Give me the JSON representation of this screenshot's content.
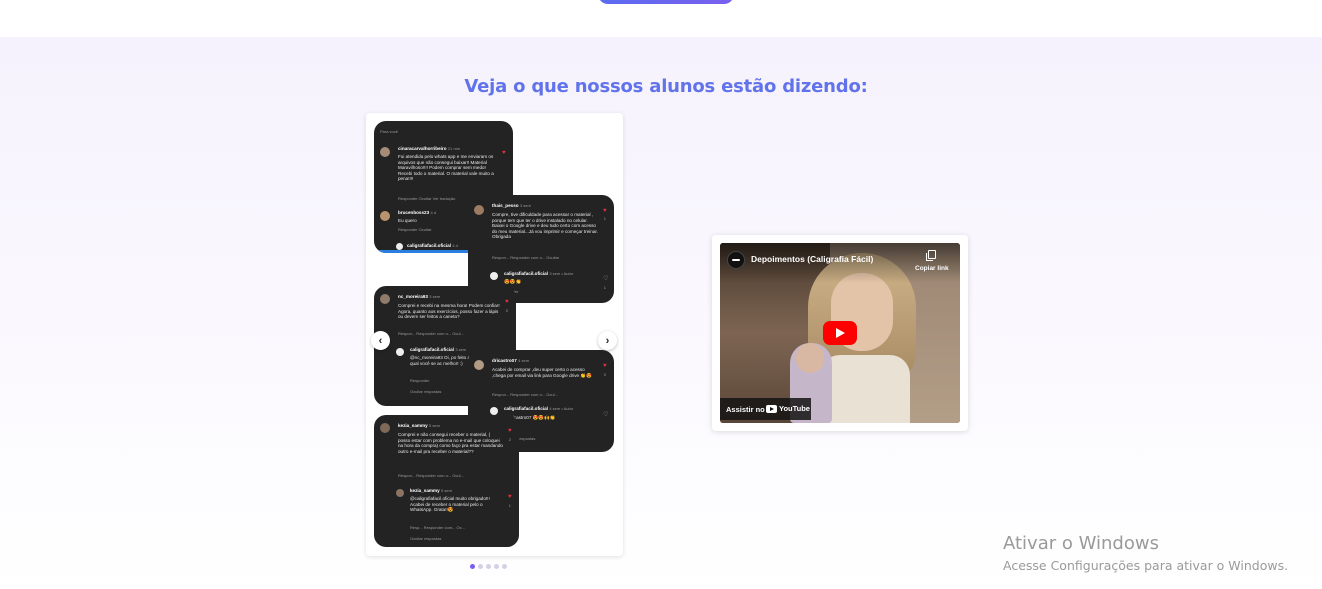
{
  "section": {
    "heading": "Veja o que nossos alunos estão dizendo:"
  },
  "carousel": {
    "prev_icon": "chevron-left-icon",
    "next_icon": "chevron-right-icon",
    "prev_glyph": "‹",
    "next_glyph": "›",
    "dot_count": 5,
    "active_dot": 0,
    "screenshots": [
      {
        "header": "Para você",
        "user": "cinaracarvalhorribeiro",
        "time": "21 min",
        "text": "Fui atendida pelo whats app e me enviaram os arquivos que não consegui baixar!! Material Maravilhoso!!!! Podem comprar sem medo! Recebi todo o material. O material vale muito a pena!!!!",
        "actions": "Responder    Ocultar    Ver tradução",
        "reply_user": "brucenboss23",
        "reply_time": "4 d",
        "reply_text": "Eu quero",
        "reply_actions": "Responder    Ocultar",
        "footer_user": "caligrafiafacil.oficial",
        "footer_time": "4 d"
      },
      {
        "user": "thais_pesso",
        "time": "3 sem",
        "text": "Compre, tive dificuldade para acessar o material , porque tem que ter o drive instalado no celular. Baixei o Google drive e deu tudo certo com acesso do meu material...Já vou imprimir e começar treinar. Obrigada",
        "actions": "Respon...    Responder com o...    Ocultar",
        "like_count": "1",
        "reply_user": "caligrafiafacil.oficial",
        "reply_time": "3 sem • Autor",
        "reply_text": "😍😍👏",
        "reply_actions": "sponder",
        "reply_like_count": "1"
      },
      {
        "user": "nc_moreira93",
        "time": "3 sem",
        "text": "Comprei e recebi na mesma hora! Podem confiar! Agora, quanto aos exercícios, posso fazer a lápis ou devem ser feitos a caneta?",
        "actions": "Respon...    Responder com o...    Ocul...",
        "like_count": "0",
        "reply_user": "caligrafiafacil.oficial",
        "reply_time": "3 sem",
        "reply_text": "@nc_moreira93 Oi, po feito a qual você se ac melhor! :)",
        "reply_actions": "Responder",
        "more": "Ocultar respostas"
      },
      {
        "user": "dricastro07",
        "time": "4 sem",
        "text": "Acabei de comprar ,deu super certo o acesso ,chega por email via link para Google drive 👏😍",
        "actions": "Respon...    Responder com o...    Ocul...",
        "like_count": "0",
        "reply_user": "caligrafiafacil.oficial",
        "reply_time": "4 sem • Autor",
        "reply_text": "@dricastro07 😍😍🙌👏",
        "reply_actions": "nder",
        "more": "Ocultar respostas"
      },
      {
        "user": "kezia_sammy",
        "time": "5 sem",
        "text": "Comprei e não consegui receber o material, ( posso estar com problema no e-mail que coloquei na hora da compra) como faço pra estar mandando outro e-mail pra receber o material??",
        "actions": "Respon...    Responder com o...    Ocul...",
        "like_count": "2",
        "reply_user": "kezia_sammy",
        "reply_time": "5 sem",
        "reply_text": "@caligrafiafacil.oficial muito obrigado!!! Acabei de receber o material pelo o WhatsApp. Grata!!😍",
        "reply_actions": "Resp...    Responder com...    Oc...",
        "reply_like_count": "1",
        "more": "Ocultar respostas"
      }
    ]
  },
  "video": {
    "channel_icon": "channel-logo-icon",
    "title": "Depoimentos (Caligrafia Fácil)",
    "copy_icon": "copy-link-icon",
    "copy_label": "Copiar link",
    "play_icon": "play-icon",
    "watch_on": "Assistir no",
    "brand": "YouTube"
  },
  "windows_watermark": {
    "title": "Ativar o Windows",
    "subtitle": "Acesse Configurações para ativar o Windows."
  },
  "colors": {
    "heading": "#6173ea",
    "accent": "#7a5cf0",
    "youtube_red": "#ff0000",
    "comment_bg": "#232323"
  }
}
